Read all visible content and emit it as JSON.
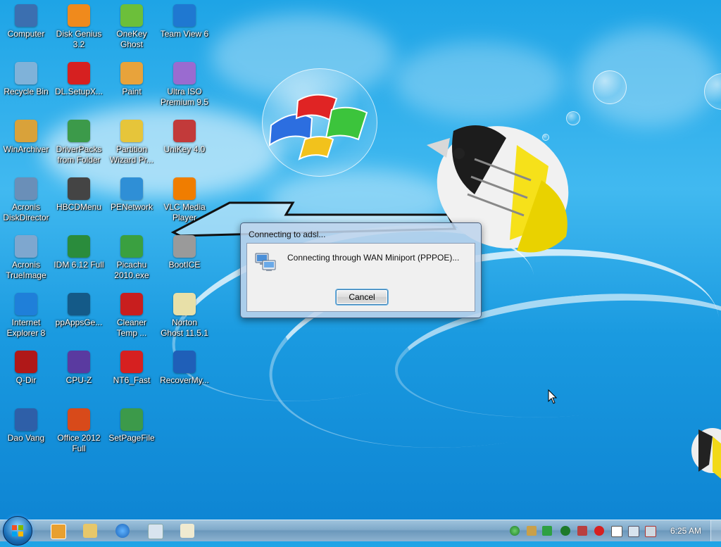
{
  "desktop": {
    "icons": [
      {
        "label": "Computer",
        "name": "computer-icon",
        "color": "#3b6fb0"
      },
      {
        "label": "Disk Genius\n3.2",
        "name": "disk-genius-icon",
        "color": "#f08a1c"
      },
      {
        "label": "OneKey\nGhost",
        "name": "onekey-ghost-icon",
        "color": "#6cbf3a"
      },
      {
        "label": "Team View 6",
        "name": "teamviewer-icon",
        "color": "#1f78d1"
      },
      {
        "label": "Recycle Bin",
        "name": "recycle-bin-icon",
        "color": "#7fb2d9"
      },
      {
        "label": "DL.SetupX...",
        "name": "dl-setupx-icon",
        "color": "#d62020"
      },
      {
        "label": "Paint",
        "name": "paint-icon",
        "color": "#e8a33b"
      },
      {
        "label": "Ultra ISO\nPremium 9.5",
        "name": "ultraiso-icon",
        "color": "#9a6bd0"
      },
      {
        "label": "WinArchiver",
        "name": "winarchiver-icon",
        "color": "#d9a23a"
      },
      {
        "label": "DriverPacks\nfrom Folder",
        "name": "driverpacks-icon",
        "color": "#3c9a4a"
      },
      {
        "label": "Partition\nWizard Pr...",
        "name": "partition-wizard-icon",
        "color": "#e6c53a"
      },
      {
        "label": "UniKey 4.0",
        "name": "unikey-icon",
        "color": "#c23a3a"
      },
      {
        "label": "Acronis\nDiskDirector",
        "name": "acronis-diskdirector-icon",
        "color": "#6a8fb8"
      },
      {
        "label": "HBCDMenu",
        "name": "hbcdmenu-icon",
        "color": "#444444"
      },
      {
        "label": "PENetwork",
        "name": "penetwork-icon",
        "color": "#2f8fd6"
      },
      {
        "label": "VLC Media\nPlayer",
        "name": "vlc-icon",
        "color": "#f07d00"
      },
      {
        "label": "Acronis\nTrueImage",
        "name": "acronis-trueimage-icon",
        "color": "#7ea7cf"
      },
      {
        "label": "IDM 6.12 Full",
        "name": "idm-icon",
        "color": "#2a8c3c"
      },
      {
        "label": "Picachu\n2010.exe",
        "name": "picachu-icon",
        "color": "#3aa040"
      },
      {
        "label": "BootICE",
        "name": "bootice-icon",
        "color": "#9a9a9a"
      },
      {
        "label": "Internet\nExplorer 8",
        "name": "internet-explorer-icon",
        "color": "#1f7fd9"
      },
      {
        "label": "ppAppsGe...",
        "name": "ppappsge-icon",
        "color": "#145a88"
      },
      {
        "label": "Cleaner\nTemp ...",
        "name": "cleaner-temp-icon",
        "color": "#c81e1e"
      },
      {
        "label": "Norton\nGhost 11.5.1",
        "name": "norton-ghost-icon",
        "color": "#e8e0a8"
      },
      {
        "label": "Q-Dir",
        "name": "q-dir-icon",
        "color": "#b01818"
      },
      {
        "label": "CPU-Z",
        "name": "cpu-z-icon",
        "color": "#5a3aa0"
      },
      {
        "label": "NT6_Fast",
        "name": "nt6-fast-icon",
        "color": "#d62020"
      },
      {
        "label": "RecoverMy...",
        "name": "recovermy-icon",
        "color": "#1f5fb8"
      },
      {
        "label": "Dao Vang",
        "name": "dao-vang-icon",
        "color": "#2e5fa8"
      },
      {
        "label": "Office 2012\nFull",
        "name": "office-icon",
        "color": "#d84a1a"
      },
      {
        "label": "SetPageFile",
        "name": "setpagefile-icon",
        "color": "#3c9a4a"
      }
    ]
  },
  "dialog": {
    "title": "Connecting to adsl...",
    "message": "Connecting through WAN Miniport (PPPOE)...",
    "cancel_label": "Cancel"
  },
  "taskbar": {
    "clock": "6:25 AM"
  }
}
